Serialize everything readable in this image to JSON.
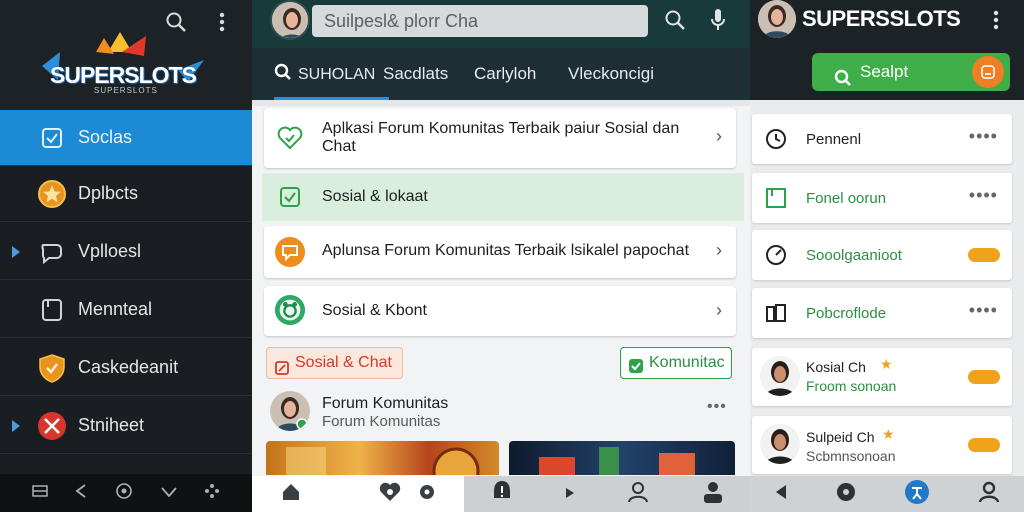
{
  "left": {
    "brand_main": "SUPERSLOTS",
    "brand_sub": "SUPERSLOTS",
    "items": [
      {
        "label": "Soclas",
        "icon": "square-check-icon"
      },
      {
        "label": "Dplbcts",
        "icon": "star-badge-icon"
      },
      {
        "label": "Vplloesl",
        "icon": "chat-bubble-icon"
      },
      {
        "label": "Mennteal",
        "icon": "document-icon"
      },
      {
        "label": "Caskedeanit",
        "icon": "shield-icon"
      },
      {
        "label": "Stniheet",
        "icon": "crossed-swords-icon"
      }
    ]
  },
  "mid": {
    "search_placeholder": "Suilpesl& plorr Cha",
    "tabs": [
      "SUHOLAN",
      "Sacdlats",
      "Carlyloh",
      "Vleckoncigi"
    ],
    "cards": [
      {
        "title": "Aplkasi Forum Komunitas Terbaik paiur Sosial dan Chat"
      },
      {
        "title": "Sosial & lokaat"
      },
      {
        "title": "Aplunsa Forum Komunitas Terbaik lsikalel papochat"
      },
      {
        "title": "Sosial & Kbont"
      }
    ],
    "pill_left": "Sosial & Chat",
    "pill_right": "Komunitac",
    "post_title": "Forum Komunitas",
    "post_subtitle": "Forum Komunitas",
    "post_menu": "•••"
  },
  "right": {
    "brand": "SUPERSSLOTS",
    "search_button": "Sealpt",
    "items": [
      {
        "label": "Pennenl",
        "trail": "dots"
      },
      {
        "label": "Fonel oorun",
        "trail": "dots"
      },
      {
        "label": "Sooolgaanioot",
        "trail": "tag"
      },
      {
        "label": "Pobcroflode",
        "trail": "dots"
      }
    ],
    "people": [
      {
        "name": "Kosial Ch",
        "sub": "Froom sonoan"
      },
      {
        "name": "Sulpeid Ch",
        "sub": "Scbmnsonoan"
      }
    ],
    "dots": "••••"
  }
}
